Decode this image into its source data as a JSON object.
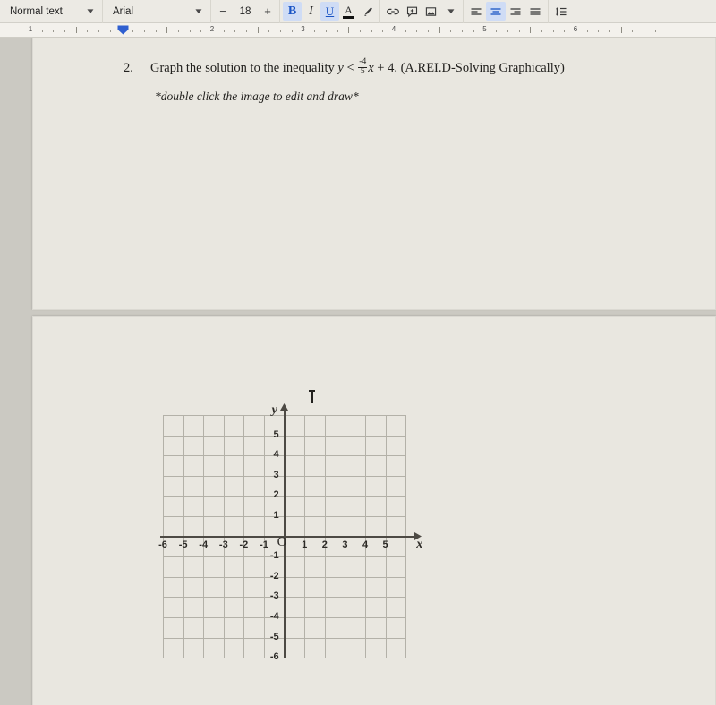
{
  "toolbar": {
    "paragraph_style": "Normal text",
    "font_family": "Arial",
    "font_size": "18",
    "decrease_label": "−",
    "increase_label": "+",
    "bold_label": "B",
    "italic_label": "I",
    "underline_label": "U",
    "text_color_label": "A",
    "icons": {
      "style_caret": "chevron-down-icon",
      "font_caret": "chevron-down-icon",
      "highlight": "highlight-pen-icon",
      "link": "insert-link-icon",
      "comment": "add-comment-icon",
      "image": "insert-image-icon",
      "image_caret": "chevron-down-icon",
      "align_left": "align-left-icon",
      "align_center": "align-center-icon",
      "align_right": "align-right-icon",
      "align_justify": "align-justify-icon",
      "line_spacing": "line-spacing-icon"
    },
    "active": {
      "bold": true,
      "underline": true,
      "align_center": true
    }
  },
  "ruler": {
    "numbers": [
      "1",
      "1",
      "2",
      "3",
      "4",
      "5",
      "6"
    ],
    "indent_marker": "left-indent-marker"
  },
  "document": {
    "question_number": "2.",
    "question_text_before": "Graph the solution to the inequality",
    "equation": {
      "y": "y",
      "relation": "<",
      "fraction_numerator": "-4",
      "fraction_denominator": "5",
      "variable": "x",
      "plus": "+",
      "constant": "4"
    },
    "question_text_after": ". (A.REI.D-Solving Graphically)",
    "note": "*double click the image to edit and draw*"
  },
  "graph": {
    "x_axis_name": "x",
    "y_axis_name": "y",
    "origin_label": "O",
    "x_labels": [
      "-6",
      "-5",
      "-4",
      "-3",
      "-2",
      "-1",
      "1",
      "2",
      "3",
      "4",
      "5"
    ],
    "y_labels": [
      "5",
      "4",
      "3",
      "2",
      "1",
      "-1",
      "-2",
      "-3",
      "-4",
      "-5",
      "-6"
    ],
    "grid_color": "#b3b1a8",
    "axis_color": "#4d4a44"
  },
  "cursor": {
    "type": "text-ibeam-cursor"
  },
  "chart_data": {
    "type": "line",
    "title": "",
    "xlabel": "x",
    "ylabel": "y",
    "xlim": [
      -6.5,
      5.5
    ],
    "ylim": [
      -6.5,
      5.5
    ],
    "xticks": [
      -6,
      -5,
      -4,
      -3,
      -2,
      -1,
      1,
      2,
      3,
      4,
      5
    ],
    "yticks": [
      5,
      4,
      3,
      2,
      1,
      -1,
      -2,
      -3,
      -4,
      -5,
      -6
    ],
    "grid": true,
    "legend": "none",
    "series": [],
    "annotations": [
      "O"
    ]
  }
}
